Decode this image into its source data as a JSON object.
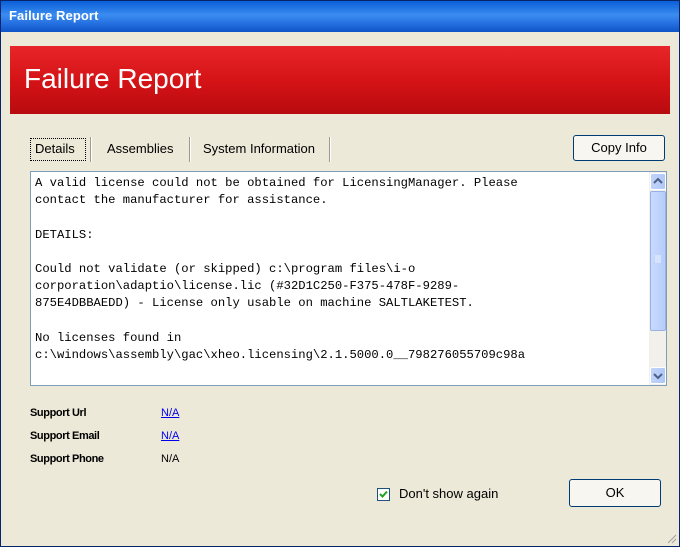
{
  "window": {
    "title": "Failure Report"
  },
  "banner": {
    "title": "Failure Report"
  },
  "tabs": [
    {
      "label": "Details"
    },
    {
      "label": "Assemblies"
    },
    {
      "label": "System Information"
    }
  ],
  "copy_button": {
    "label": "Copy Info"
  },
  "details_text": "A valid license could not be obtained for LicensingManager. Please\ncontact the manufacturer for assistance.\n\nDETAILS:\n\nCould not validate (or skipped) c:\\program files\\i-o\ncorporation\\adaptio\\license.lic (#32D1C250-F375-478F-9289-\n875E4DBBAEDD) - License only usable on machine SALTLAKETEST.\n\nNo licenses found in\nc:\\windows\\assembly\\gac\\xheo.licensing\\2.1.5000.0__798276055709c98a",
  "support": {
    "url_label": "Support Url",
    "url_value": "N/A",
    "email_label": "Support Email",
    "email_value": "N/A",
    "phone_label": "Support Phone",
    "phone_value": "N/A"
  },
  "dont_show_again": {
    "label": "Don't show again",
    "checked": true
  },
  "ok_button": {
    "label": "OK"
  },
  "colors": {
    "titlebar": "#0a5fd8",
    "banner": "#d31216",
    "dialog_bg": "#ece9d8"
  }
}
